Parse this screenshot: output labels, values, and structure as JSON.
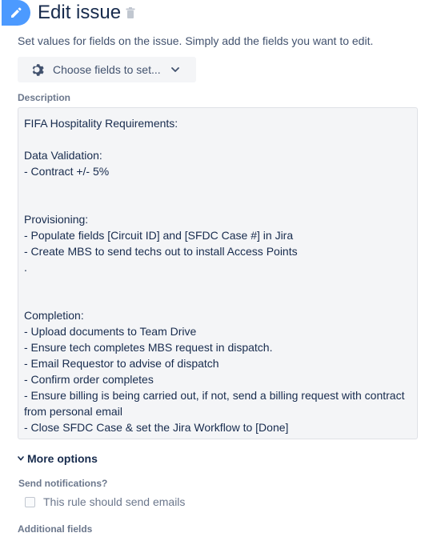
{
  "header": {
    "title": "Edit issue",
    "subtitle": "Set values for fields on the issue. Simply add the fields you want to edit."
  },
  "choose_fields": {
    "label": "Choose fields to set..."
  },
  "description": {
    "label": "Description",
    "value": "FIFA Hospitality Requirements:\n\nData Validation:\n- Contract +/- 5%\n\n\nProvisioning:\n- Populate fields [Circuit ID] and [SFDC Case #] in Jira\n- Create MBS to send techs out to install Access Points\n.\n\n\nCompletion:\n- Upload documents to Team Drive\n- Ensure tech completes MBS request in dispatch.\n- Email Requestor to advise of dispatch\n- Confirm order completes\n- Ensure billing is being carried out, if not, send a billing request with contract from personal email\n- Close SFDC Case & set the Jira Workflow to [Done]"
  },
  "more_options": {
    "label": "More options"
  },
  "notifications": {
    "label": "Send notifications?",
    "checkbox_label": "This rule should send emails",
    "checked": false
  },
  "additional_fields": {
    "label": "Additional fields"
  },
  "colors": {
    "accent": "#4c9aff",
    "text": "#172b4d",
    "muted": "#6b778c",
    "field_bg": "#f4f5f7"
  },
  "icons": [
    "pencil-icon",
    "trash-icon",
    "gear-icon",
    "chevron-down-icon"
  ]
}
